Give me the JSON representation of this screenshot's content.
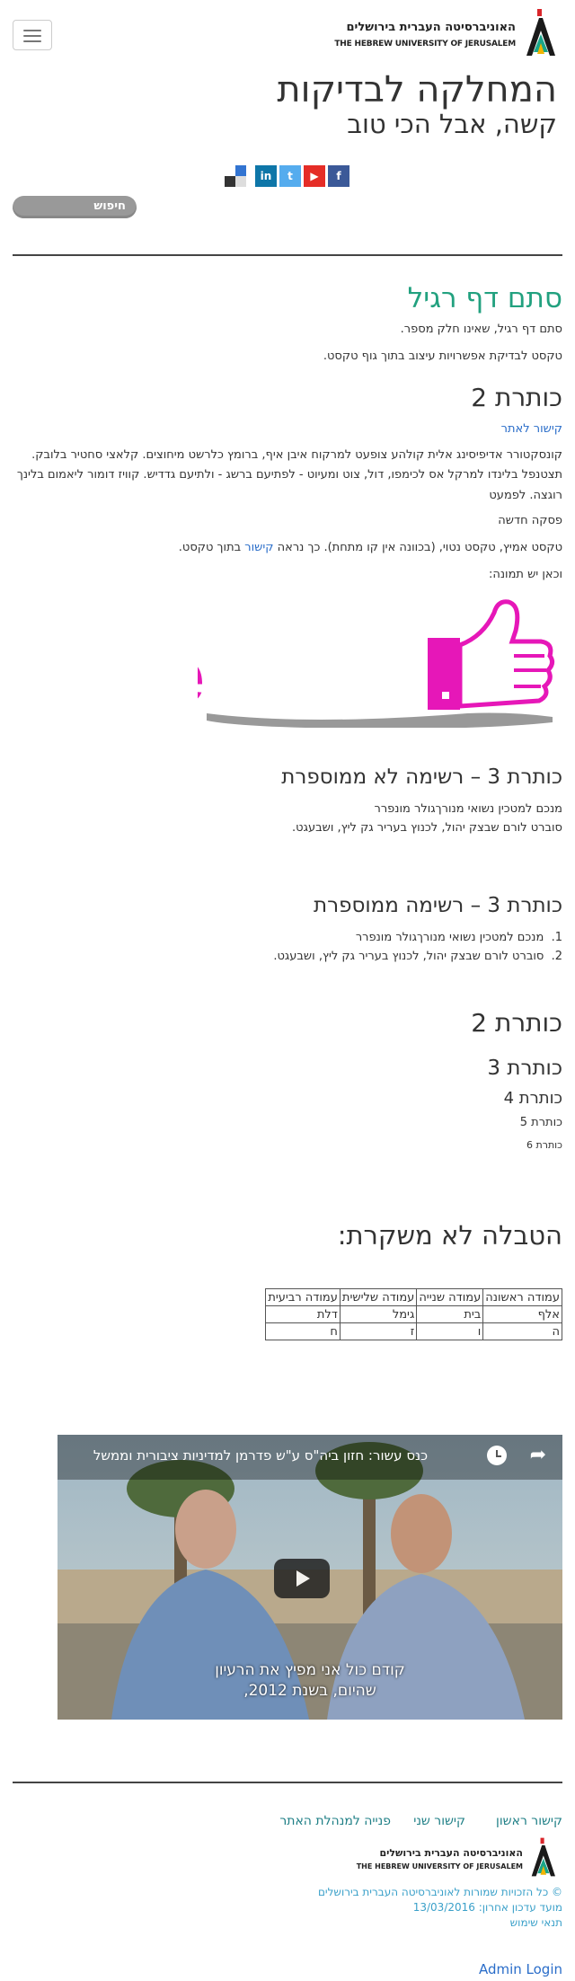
{
  "header": {
    "logo_he": "האוניברסיטה העברית בירושלים",
    "logo_en": "THE HEBREW UNIVERSITY OF JERUSALEM",
    "site_title": "המחלקה לבדיקות",
    "site_subtitle": "קשה, אבל הכי טוב",
    "social": [
      {
        "name": "facebook",
        "glyph": "f",
        "color": "#3b5998"
      },
      {
        "name": "youtube",
        "glyph": "▶",
        "color": "#e52d27"
      },
      {
        "name": "twitter",
        "glyph": "t",
        "color": "#55acee"
      },
      {
        "name": "linkedin",
        "glyph": "in",
        "color": "#0e76a8"
      },
      {
        "name": "delicious",
        "glyph": "",
        "color": "#3274d1"
      }
    ],
    "search_label": "חיפוש"
  },
  "content": {
    "page_heading": "סתם דף רגיל",
    "intro1": "סתם דף רגיל, שאינו חלק מספר.",
    "intro2": "טקסט לבדיקת אפשרויות עיצוב בתוך גוף טקסט.",
    "h2_first": "כותרת 2",
    "other_site_link": "קישור לאתר",
    "lorem_line1": "קונסקטורר אדיפיסינג אלית קולהע צופעט למרקוח איבן איף, ברומץ כלרשט מיחוצים. קלאצי סחטיר בלובק.",
    "lorem_line2": "תצטנפל בלינדו למרקל אס לכימפו, דול, צוט ומעיוט - לפתיעם ברשג - ולתיעם גדדיש. קוויז דומור ליאמום בלינך",
    "lorem_line3": "רוגצה. לפמעט",
    "new_paragraph": "פסקה חדשה",
    "emph_before": "טקסט אמיץ, טקסט נטוי, (בכוונה אין קו מתחת). כך נראה ",
    "emph_link": "קישור",
    "emph_after": " בתוך טקסט.",
    "image_intro": "וכאן יש תמונה:",
    "image_text": "Like",
    "h3_unordered": "כותרת 3 – רשימה לא ממוספרת",
    "unordered": [
      "מנכם למטכין נשואי מנורךגולר מונפרר",
      "סוברט לורם שבצק יהול, לכנוץ בעריר גק ליץ, ושבעגט."
    ],
    "h3_ordered": "כותרת 3 – רשימה ממוספרת",
    "ordered": [
      "מנכם למטכין נשואי מנורךגולר מונפרר",
      "סוברט לורם שבצק יהול, לכנוץ בעריר גק ליץ, ושבעגט."
    ],
    "ordered_nums": [
      "1.",
      "2."
    ],
    "hd2": "כותרת 2",
    "hd3": "כותרת 3",
    "hd4": "כותרת 4",
    "hd5": "כותרת 5",
    "hd6": "כותרת 6",
    "table_heading": "הטבלה לא משקרת:",
    "table": {
      "headers": [
        "עמודה ראשונה",
        "עמודה שנייה",
        "עמודה שלישית",
        "עמודה רביעית"
      ],
      "rows": [
        [
          "אלף",
          "בית",
          "גימל",
          "דלת"
        ],
        [
          "ה",
          "ו",
          "ז",
          "ח"
        ]
      ]
    },
    "video_title": "כנס עשור: חזון ביה\"ס ע\"ש פדרמן למדיניות ציבורית וממשל",
    "video_caption1": "קודם כול אני מפיץ את הרעיון",
    "video_caption2": "שהיום, בשנת 2012,"
  },
  "footer": {
    "links": [
      "קישור ראשון",
      "קישור שני",
      "פנייה למנהלת האתר"
    ],
    "logo_he": "האוניברסיטה העברית בירושלים",
    "logo_en": "THE HEBREW UNIVERSITY OF JERUSALEM",
    "copyright": "© כל הזכויות שמורות לאוניברסיטה העברית בירושלים",
    "updated": "מועד עדכון אחרון: 13/03/2016",
    "terms": "תנאי שימוש",
    "admin_login": "Admin Login"
  },
  "colors": {
    "accent": "#22a17f",
    "link": "#2a6dc9",
    "footer_link": "#1f7f86",
    "like_pink": "#e617b8"
  }
}
